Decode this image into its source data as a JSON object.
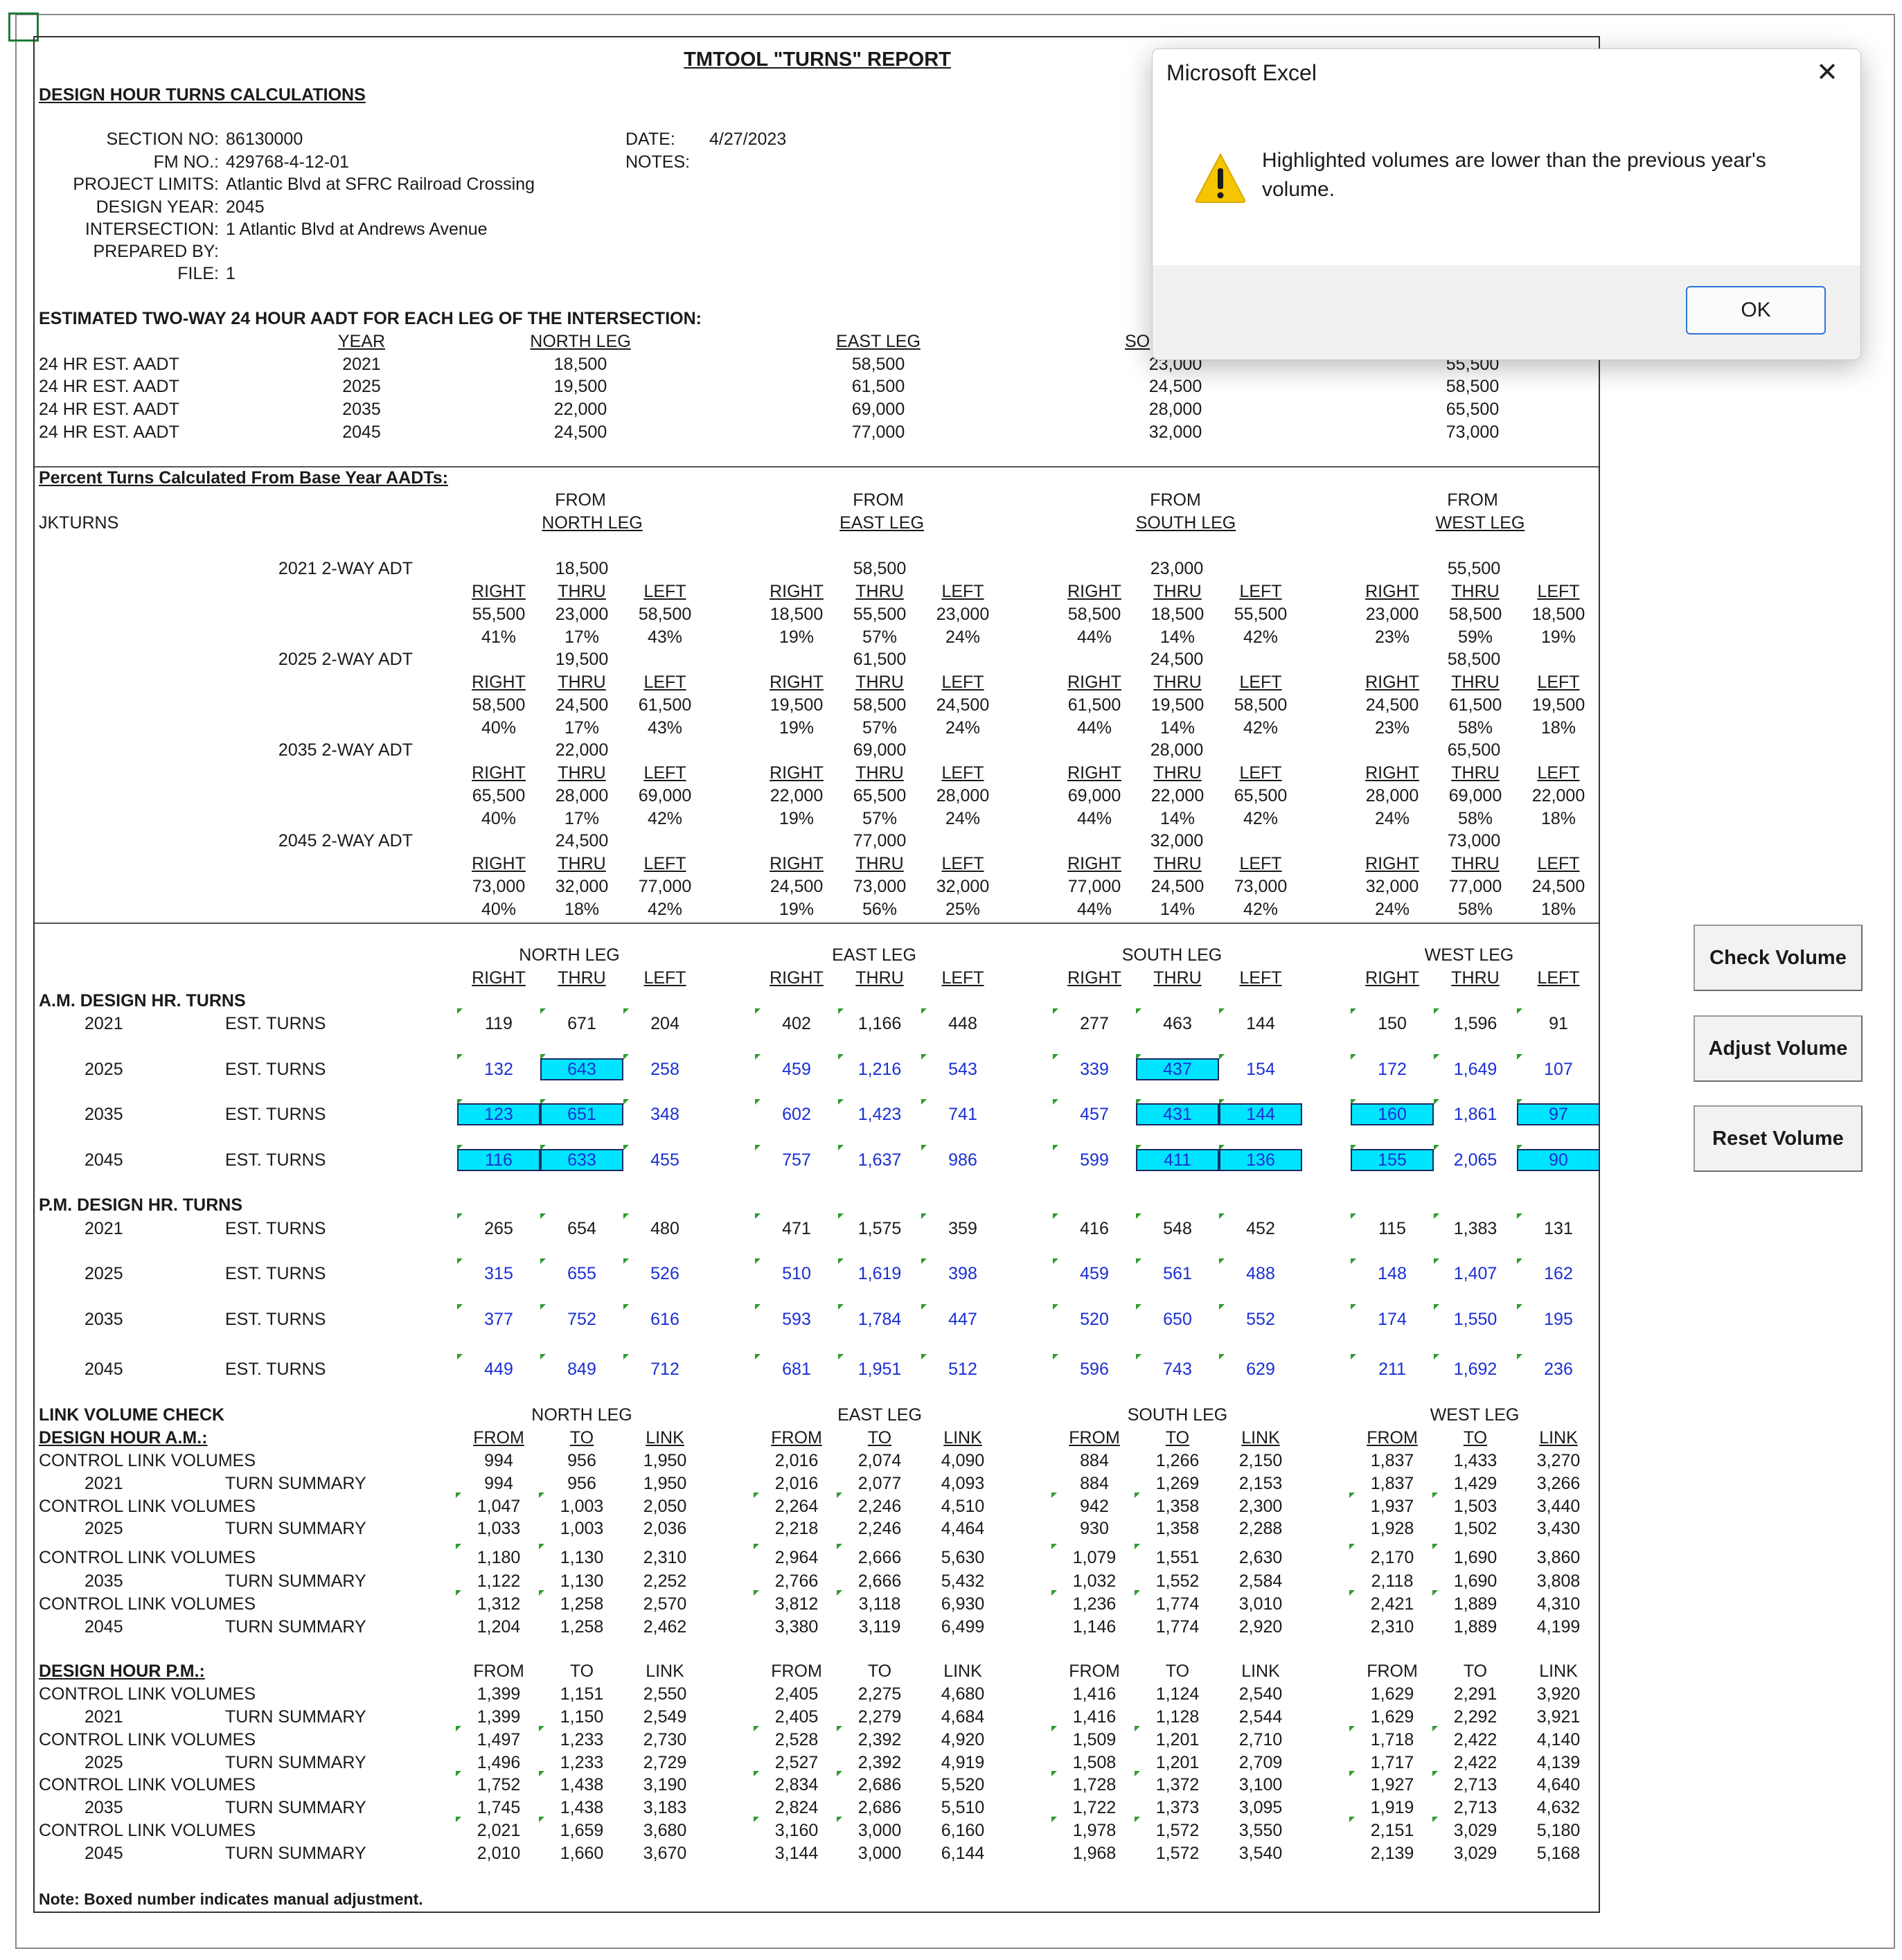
{
  "window": {
    "dialog_title": "Microsoft Excel",
    "dialog_message": "Highlighted volumes are lower than the previous year's volume.",
    "ok_label": "OK",
    "close_label": "✕"
  },
  "buttons": {
    "check": "Check Volume",
    "adjust": "Adjust Volume",
    "reset": "Reset Volume"
  },
  "report": {
    "title": "TMTOOL \"TURNS\" REPORT",
    "section_heading": "DESIGN HOUR TURNS CALCULATIONS",
    "info": [
      {
        "label": "SECTION  NO:",
        "value": "86130000"
      },
      {
        "label": "FM NO.:",
        "value": "429768-4-12-01"
      },
      {
        "label": "PROJECT LIMITS:",
        "value": "Atlantic Blvd at SFRC Railroad Crossing"
      },
      {
        "label": "DESIGN YEAR:",
        "value": "2045"
      },
      {
        "label": "INTERSECTION:",
        "value": "1 Atlantic Blvd at Andrews Avenue"
      },
      {
        "label": "PREPARED BY:",
        "value": ""
      },
      {
        "label": "FILE:",
        "value": "1"
      }
    ],
    "date_label": "DATE:",
    "date_value": "4/27/2023",
    "notes_label": "NOTES:",
    "aadt_heading": "ESTIMATED TWO-WAY 24 HOUR AADT FOR EACH LEG OF THE INTERSECTION:",
    "aadt_headers": {
      "year": "YEAR",
      "north": "NORTH LEG",
      "east": "EAST LEG",
      "south": "SO"
    },
    "aadt_rows": [
      {
        "label": "24 HR EST. AADT",
        "year": "2021",
        "north": "18,500",
        "east": "58,500",
        "south": "23,000",
        "west": "55,500"
      },
      {
        "label": "24 HR EST. AADT",
        "year": "2025",
        "north": "19,500",
        "east": "61,500",
        "south": "24,500",
        "west": "58,500"
      },
      {
        "label": "24 HR EST. AADT",
        "year": "2035",
        "north": "22,000",
        "east": "69,000",
        "south": "28,000",
        "west": "65,500"
      },
      {
        "label": "24 HR EST. AADT",
        "year": "2045",
        "north": "24,500",
        "east": "77,000",
        "south": "32,000",
        "west": "73,000"
      }
    ],
    "pct_heading": "Percent Turns Calculated From Base Year AADTs:",
    "jkturns": "JKTURNS",
    "from_label": "FROM",
    "legs_from": [
      "NORTH LEG",
      "EAST LEG",
      "SOUTH LEG",
      "WEST LEG"
    ],
    "rtl": [
      "RIGHT",
      "THRU",
      "LEFT"
    ],
    "pct_blocks": [
      {
        "label": "2021 2-WAY ADT",
        "adt": [
          "18,500",
          "58,500",
          "23,000",
          "55,500"
        ],
        "vals": [
          [
            "55,500",
            "23,000",
            "58,500"
          ],
          [
            "18,500",
            "55,500",
            "23,000"
          ],
          [
            "58,500",
            "18,500",
            "55,500"
          ],
          [
            "23,000",
            "58,500",
            "18,500"
          ]
        ],
        "pcts": [
          [
            "41%",
            "17%",
            "43%"
          ],
          [
            "19%",
            "57%",
            "24%"
          ],
          [
            "44%",
            "14%",
            "42%"
          ],
          [
            "23%",
            "59%",
            "19%"
          ]
        ]
      },
      {
        "label": "2025 2-WAY ADT",
        "adt": [
          "19,500",
          "61,500",
          "24,500",
          "58,500"
        ],
        "vals": [
          [
            "58,500",
            "24,500",
            "61,500"
          ],
          [
            "19,500",
            "58,500",
            "24,500"
          ],
          [
            "61,500",
            "19,500",
            "58,500"
          ],
          [
            "24,500",
            "61,500",
            "19,500"
          ]
        ],
        "pcts": [
          [
            "40%",
            "17%",
            "43%"
          ],
          [
            "19%",
            "57%",
            "24%"
          ],
          [
            "44%",
            "14%",
            "42%"
          ],
          [
            "23%",
            "58%",
            "18%"
          ]
        ]
      },
      {
        "label": "2035 2-WAY ADT",
        "adt": [
          "22,000",
          "69,000",
          "28,000",
          "65,500"
        ],
        "vals": [
          [
            "65,500",
            "28,000",
            "69,000"
          ],
          [
            "22,000",
            "65,500",
            "28,000"
          ],
          [
            "69,000",
            "22,000",
            "65,500"
          ],
          [
            "28,000",
            "69,000",
            "22,000"
          ]
        ],
        "pcts": [
          [
            "40%",
            "17%",
            "42%"
          ],
          [
            "19%",
            "57%",
            "24%"
          ],
          [
            "44%",
            "14%",
            "42%"
          ],
          [
            "24%",
            "58%",
            "18%"
          ]
        ]
      },
      {
        "label": "2045 2-WAY ADT",
        "adt": [
          "24,500",
          "77,000",
          "32,000",
          "73,000"
        ],
        "vals": [
          [
            "73,000",
            "32,000",
            "77,000"
          ],
          [
            "24,500",
            "73,000",
            "32,000"
          ],
          [
            "77,000",
            "24,500",
            "73,000"
          ],
          [
            "32,000",
            "77,000",
            "24,500"
          ]
        ],
        "pcts": [
          [
            "40%",
            "18%",
            "42%"
          ],
          [
            "19%",
            "56%",
            "25%"
          ],
          [
            "44%",
            "14%",
            "42%"
          ],
          [
            "24%",
            "58%",
            "18%"
          ]
        ]
      }
    ],
    "legs": [
      "NORTH LEG",
      "EAST LEG",
      "SOUTH LEG",
      "WEST LEG"
    ],
    "am_heading": "A.M. DESIGN HR. TURNS",
    "pm_heading": "P.M. DESIGN HR. TURNS",
    "est_turns": "EST. TURNS",
    "am_rows": [
      {
        "year": "2021",
        "v": [
          "119",
          "671",
          "204",
          "402",
          "1,166",
          "448",
          "277",
          "463",
          "144",
          "150",
          "1,596",
          "91"
        ],
        "hl": []
      },
      {
        "year": "2025",
        "v": [
          "132",
          "643",
          "258",
          "459",
          "1,216",
          "543",
          "339",
          "437",
          "154",
          "172",
          "1,649",
          "107"
        ],
        "hl": [
          1,
          7
        ]
      },
      {
        "year": "2035",
        "v": [
          "123",
          "651",
          "348",
          "602",
          "1,423",
          "741",
          "457",
          "431",
          "144",
          "160",
          "1,861",
          "97"
        ],
        "hl": [
          0,
          1,
          7,
          8,
          9,
          11
        ]
      },
      {
        "year": "2045",
        "v": [
          "116",
          "633",
          "455",
          "757",
          "1,637",
          "986",
          "599",
          "411",
          "136",
          "155",
          "2,065",
          "90"
        ],
        "hl": [
          0,
          1,
          7,
          8,
          9,
          11
        ]
      }
    ],
    "pm_rows": [
      {
        "year": "2021",
        "v": [
          "265",
          "654",
          "480",
          "471",
          "1,575",
          "359",
          "416",
          "548",
          "452",
          "115",
          "1,383",
          "131"
        ],
        "hl": []
      },
      {
        "year": "2025",
        "v": [
          "315",
          "655",
          "526",
          "510",
          "1,619",
          "398",
          "459",
          "561",
          "488",
          "148",
          "1,407",
          "162"
        ],
        "hl": []
      },
      {
        "year": "2035",
        "v": [
          "377",
          "752",
          "616",
          "593",
          "1,784",
          "447",
          "520",
          "650",
          "552",
          "174",
          "1,550",
          "195"
        ],
        "hl": []
      },
      {
        "year": "2045",
        "v": [
          "449",
          "849",
          "712",
          "681",
          "1,951",
          "512",
          "596",
          "743",
          "629",
          "211",
          "1,692",
          "236"
        ],
        "hl": []
      }
    ],
    "link_heading": "LINK VOLUME CHECK",
    "link_am_heading": "DESIGN HOUR A.M.:",
    "link_pm_heading": "DESIGN HOUR P.M.:",
    "ftl": [
      "FROM",
      "TO",
      "LINK"
    ],
    "control_label": "CONTROL LINK VOLUMES",
    "summary_label": "TURN SUMMARY",
    "link_am": [
      {
        "year": "2021",
        "c": [
          "994",
          "956",
          "1,950",
          "2,016",
          "2,074",
          "4,090",
          "884",
          "1,266",
          "2,150",
          "1,837",
          "1,433",
          "3,270"
        ],
        "s": [
          "994",
          "956",
          "1,950",
          "2,016",
          "2,077",
          "4,093",
          "884",
          "1,269",
          "2,153",
          "1,837",
          "1,429",
          "3,266"
        ]
      },
      {
        "year": "2025",
        "c": [
          "1,047",
          "1,003",
          "2,050",
          "2,264",
          "2,246",
          "4,510",
          "942",
          "1,358",
          "2,300",
          "1,937",
          "1,503",
          "3,440"
        ],
        "s": [
          "1,033",
          "1,003",
          "2,036",
          "2,218",
          "2,246",
          "4,464",
          "930",
          "1,358",
          "2,288",
          "1,928",
          "1,502",
          "3,430"
        ]
      },
      {
        "year": "2035",
        "c": [
          "1,180",
          "1,130",
          "2,310",
          "2,964",
          "2,666",
          "5,630",
          "1,079",
          "1,551",
          "2,630",
          "2,170",
          "1,690",
          "3,860"
        ],
        "s": [
          "1,122",
          "1,130",
          "2,252",
          "2,766",
          "2,666",
          "5,432",
          "1,032",
          "1,552",
          "2,584",
          "2,118",
          "1,690",
          "3,808"
        ]
      },
      {
        "year": "2045",
        "c": [
          "1,312",
          "1,258",
          "2,570",
          "3,812",
          "3,118",
          "6,930",
          "1,236",
          "1,774",
          "3,010",
          "2,421",
          "1,889",
          "4,310"
        ],
        "s": [
          "1,204",
          "1,258",
          "2,462",
          "3,380",
          "3,119",
          "6,499",
          "1,146",
          "1,774",
          "2,920",
          "2,310",
          "1,889",
          "4,199"
        ]
      }
    ],
    "link_pm": [
      {
        "year": "2021",
        "c": [
          "1,399",
          "1,151",
          "2,550",
          "2,405",
          "2,275",
          "4,680",
          "1,416",
          "1,124",
          "2,540",
          "1,629",
          "2,291",
          "3,920"
        ],
        "s": [
          "1,399",
          "1,150",
          "2,549",
          "2,405",
          "2,279",
          "4,684",
          "1,416",
          "1,128",
          "2,544",
          "1,629",
          "2,292",
          "3,921"
        ]
      },
      {
        "year": "2025",
        "c": [
          "1,497",
          "1,233",
          "2,730",
          "2,528",
          "2,392",
          "4,920",
          "1,509",
          "1,201",
          "2,710",
          "1,718",
          "2,422",
          "4,140"
        ],
        "s": [
          "1,496",
          "1,233",
          "2,729",
          "2,527",
          "2,392",
          "4,919",
          "1,508",
          "1,201",
          "2,709",
          "1,717",
          "2,422",
          "4,139"
        ]
      },
      {
        "year": "2035",
        "c": [
          "1,752",
          "1,438",
          "3,190",
          "2,834",
          "2,686",
          "5,520",
          "1,728",
          "1,372",
          "3,100",
          "1,927",
          "2,713",
          "4,640"
        ],
        "s": [
          "1,745",
          "1,438",
          "3,183",
          "2,824",
          "2,686",
          "5,510",
          "1,722",
          "1,373",
          "3,095",
          "1,919",
          "2,713",
          "4,632"
        ]
      },
      {
        "year": "2045",
        "c": [
          "2,021",
          "1,659",
          "3,680",
          "3,160",
          "3,000",
          "6,160",
          "1,978",
          "1,572",
          "3,550",
          "2,151",
          "3,029",
          "5,180"
        ],
        "s": [
          "2,010",
          "1,660",
          "3,670",
          "3,144",
          "3,000",
          "6,144",
          "1,968",
          "1,572",
          "3,540",
          "2,139",
          "3,029",
          "5,168"
        ]
      }
    ],
    "note": "Note: Boxed number indicates manual adjustment."
  }
}
